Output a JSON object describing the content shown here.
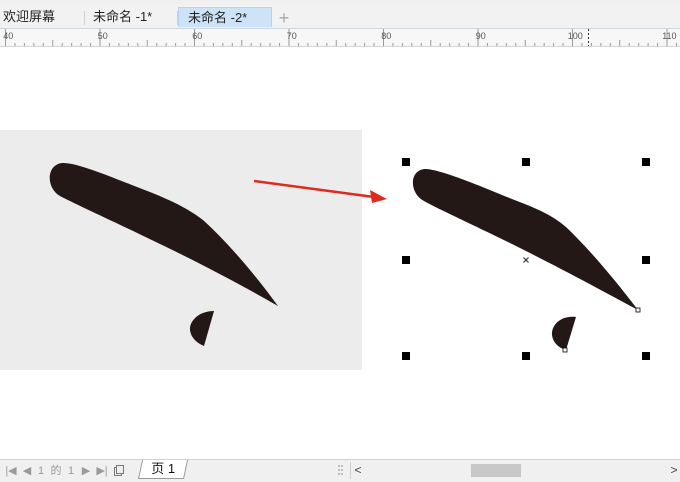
{
  "tabs": [
    {
      "label": "欢迎屏幕"
    },
    {
      "label": "未命名 -1*"
    },
    {
      "label": "未命名 -2*"
    }
  ],
  "add_tab": "+",
  "ruler": {
    "labels": [
      "40",
      "50",
      "60",
      "70",
      "80",
      "90",
      "100",
      "110"
    ]
  },
  "page_nav": {
    "first": "|◀",
    "prev": "◀",
    "current": "1",
    "of": "的",
    "total": "1",
    "next": "▶",
    "last": "▶|"
  },
  "page_tab": "页 1",
  "scroll": {
    "left": "<",
    "right": ">"
  },
  "colors": {
    "shape_fill": "#231815",
    "arrow": "#e02a1f",
    "panel": "#ececec",
    "active_tab": "#cde4f8"
  }
}
